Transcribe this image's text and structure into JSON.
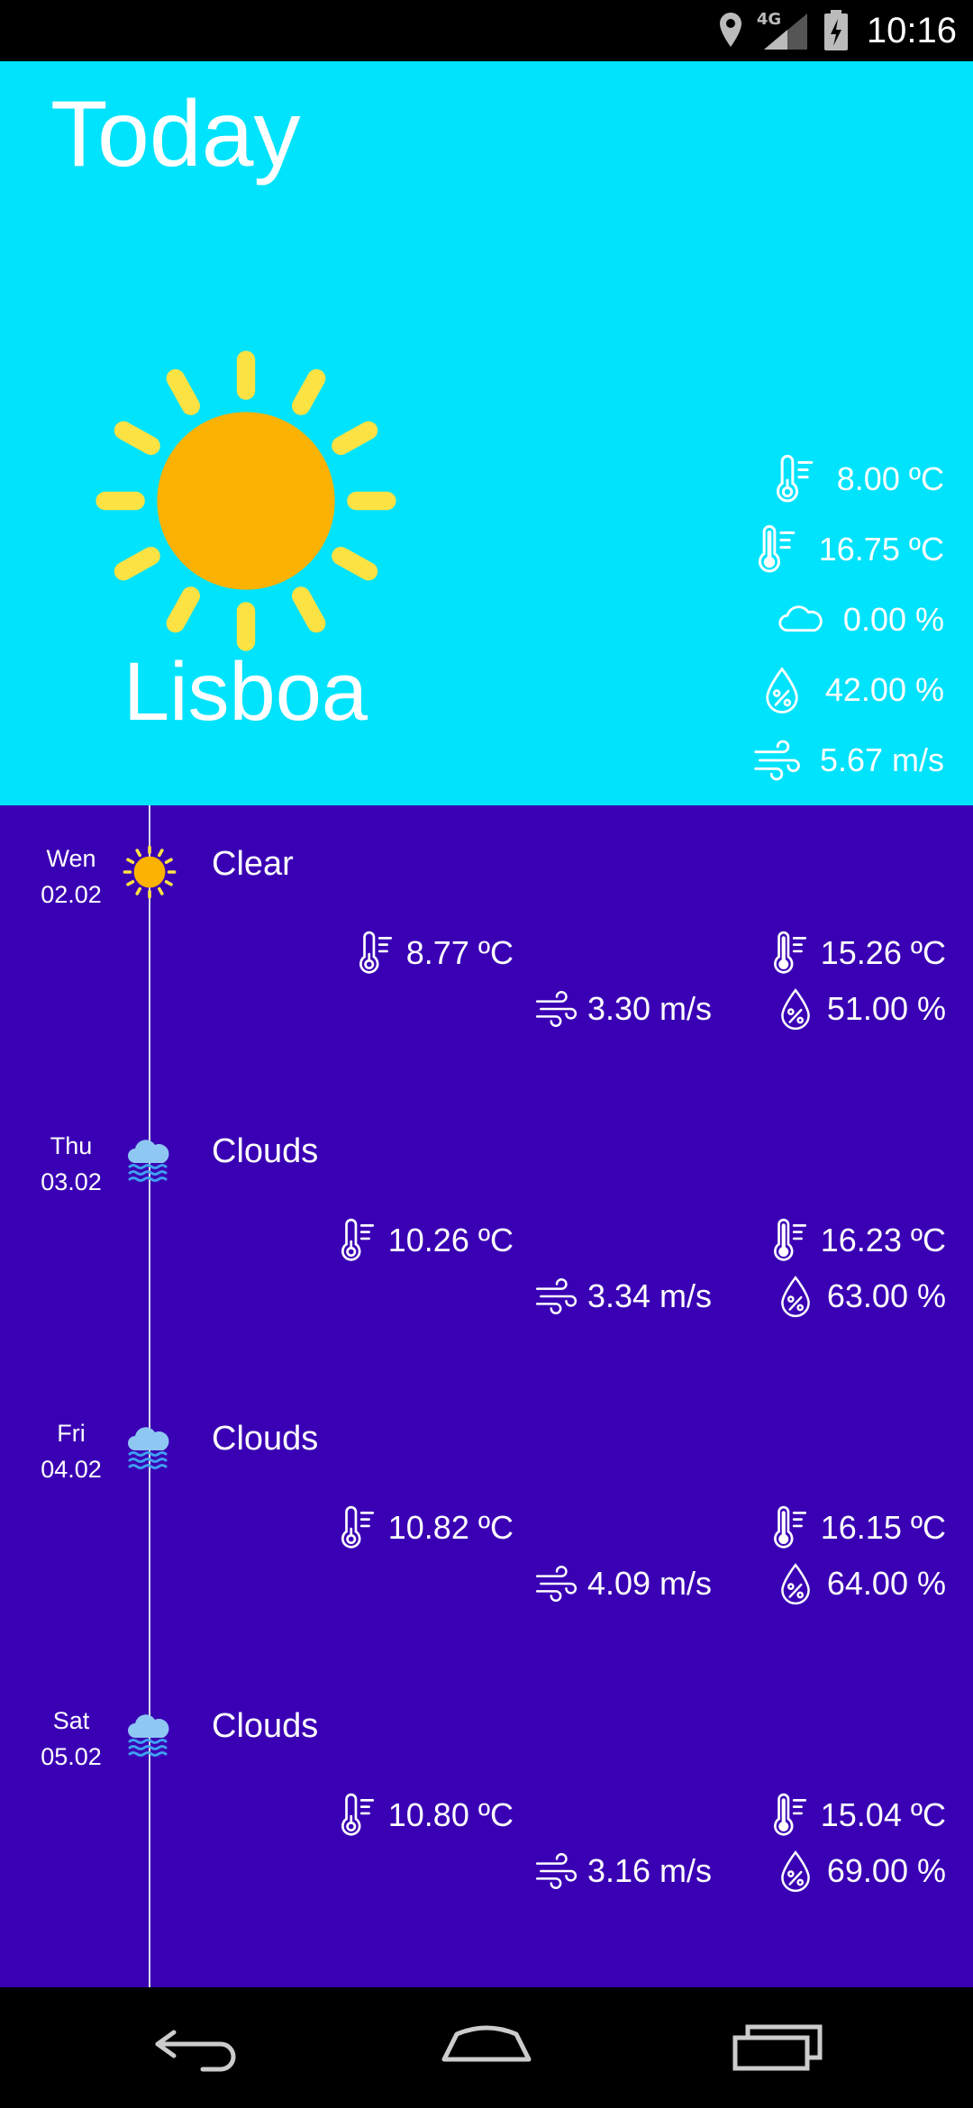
{
  "status_bar": {
    "network": "4G",
    "time": "10:16"
  },
  "today": {
    "title": "Today",
    "city": "Lisboa",
    "icon": "sun-icon",
    "stats": [
      {
        "icon": "thermometer-min-icon",
        "value": "8.00 ºC"
      },
      {
        "icon": "thermometer-max-icon",
        "value": "16.75 ºC"
      },
      {
        "icon": "cloud-icon",
        "value": "0.00 %"
      },
      {
        "icon": "humidity-icon",
        "value": "42.00 %"
      },
      {
        "icon": "wind-icon",
        "value": "5.67 m/s"
      }
    ]
  },
  "forecast": [
    {
      "day": "Wen",
      "date": "02.02",
      "icon": "sun-icon",
      "description": "Clear",
      "min_temp": "8.77 ºC",
      "max_temp": "15.26 ºC",
      "wind": "3.30 m/s",
      "humidity": "51.00 %"
    },
    {
      "day": "Thu",
      "date": "03.02",
      "icon": "cloud-rain-icon",
      "description": "Clouds",
      "min_temp": "10.26 ºC",
      "max_temp": "16.23 ºC",
      "wind": "3.34 m/s",
      "humidity": "63.00 %"
    },
    {
      "day": "Fri",
      "date": "04.02",
      "icon": "cloud-rain-icon",
      "description": "Clouds",
      "min_temp": "10.82 ºC",
      "max_temp": "16.15 ºC",
      "wind": "4.09 m/s",
      "humidity": "64.00 %"
    },
    {
      "day": "Sat",
      "date": "05.02",
      "icon": "cloud-rain-icon",
      "description": "Clouds",
      "min_temp": "10.80 ºC",
      "max_temp": "15.04 ºC",
      "wind": "3.16 m/s",
      "humidity": "69.00 %"
    }
  ],
  "nav": {
    "back": "back-icon",
    "home": "home-icon",
    "recents": "recents-icon"
  },
  "colors": {
    "today_bg": "#00e3fc",
    "forecast_bg": "#3a00b4",
    "sun": "#fbb203",
    "sun_rays": "#fde244",
    "cloud_icon": "#8fc7f3",
    "rain_lines": "#3fa0f0"
  }
}
